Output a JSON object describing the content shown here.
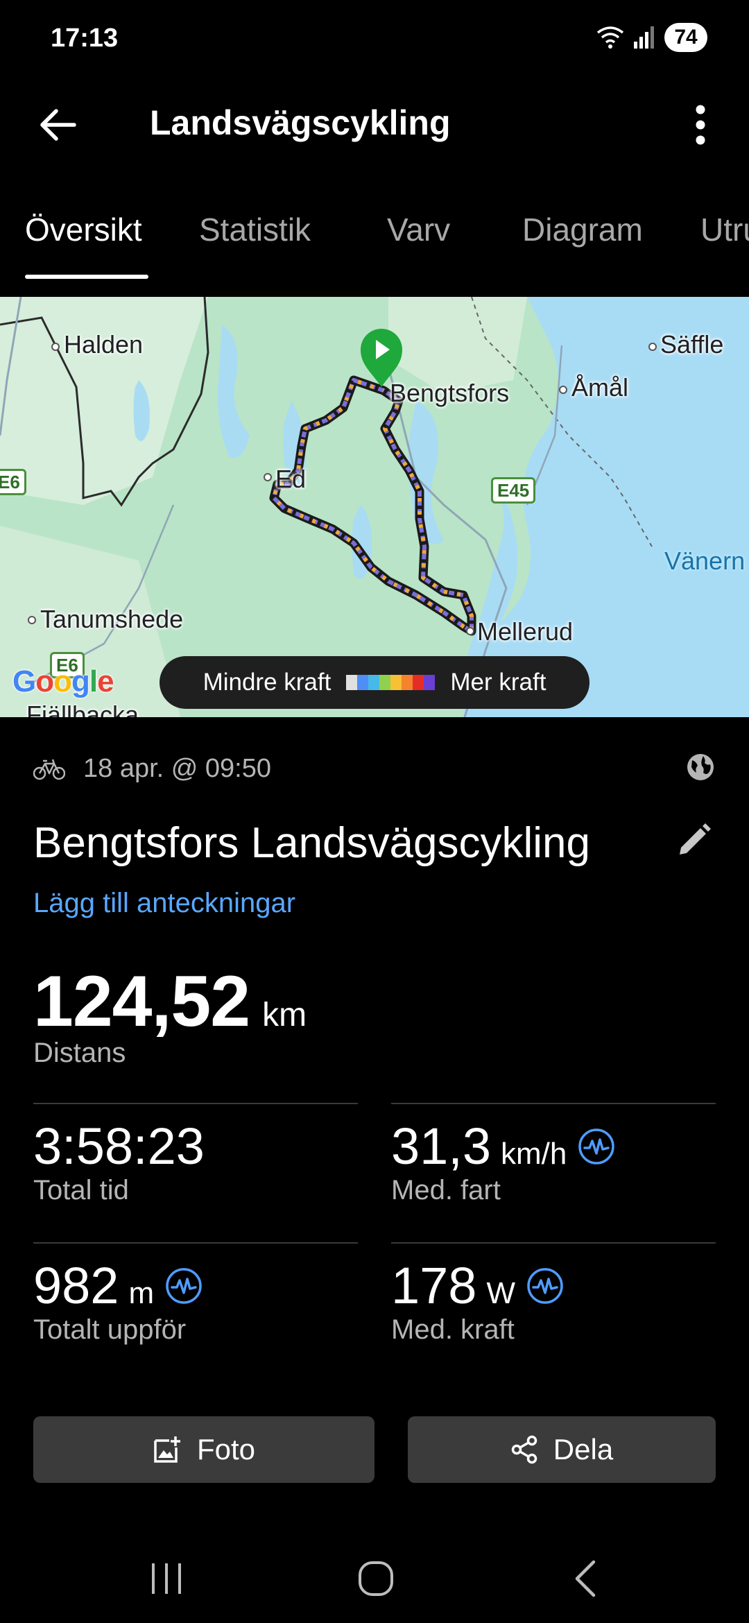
{
  "status_bar": {
    "time": "17:13",
    "battery": "74"
  },
  "app_bar": {
    "title": "Landsvägscykling"
  },
  "tabs": [
    {
      "label": "Översikt",
      "active": true
    },
    {
      "label": "Statistik",
      "active": false
    },
    {
      "label": "Varv",
      "active": false
    },
    {
      "label": "Diagram",
      "active": false
    },
    {
      "label": "Utru",
      "active": false
    }
  ],
  "map": {
    "places": {
      "halden": "Halden",
      "saffle": "Säffle",
      "bengtsfors": "Bengtsfors",
      "amal": "Åmål",
      "ed": "Ed",
      "vanern": "Vänern",
      "tanumshede": "Tanumshede",
      "mellerud": "Mellerud",
      "fjallbacka": "Fjällbacka"
    },
    "roads": {
      "e6_left": "E6",
      "e45": "E45",
      "e6_bottom": "E6"
    },
    "legend": {
      "min_label": "Mindre kraft",
      "max_label": "Mer kraft",
      "colors": [
        "#e0e0e0",
        "#4f8ef7",
        "#46b9e8",
        "#8fd14f",
        "#f7c035",
        "#f5822c",
        "#e52d27",
        "#6a3fd6"
      ]
    },
    "attribution": "Google"
  },
  "activity": {
    "date": "18 apr. @ 09:50",
    "name": "Bengtsfors Landsvägscykling",
    "add_notes": "Lägg till anteckningar",
    "distance_value": "124,52",
    "distance_unit": "km",
    "distance_label": "Distans"
  },
  "stats": {
    "total_time": {
      "value": "3:58:23",
      "unit": "",
      "label": "Total tid"
    },
    "avg_speed": {
      "value": "31,3",
      "unit": "km/h",
      "label": "Med. fart"
    },
    "ascent": {
      "value": "982",
      "unit": "m",
      "label": "Totalt uppför"
    },
    "avg_power": {
      "value": "178",
      "unit": "W",
      "label": "Med. kraft"
    }
  },
  "buttons": {
    "photo": "Foto",
    "share": "Dela"
  },
  "colors": {
    "accent": "#5aa7ff",
    "background": "#000000",
    "button": "#3b3b3b"
  }
}
